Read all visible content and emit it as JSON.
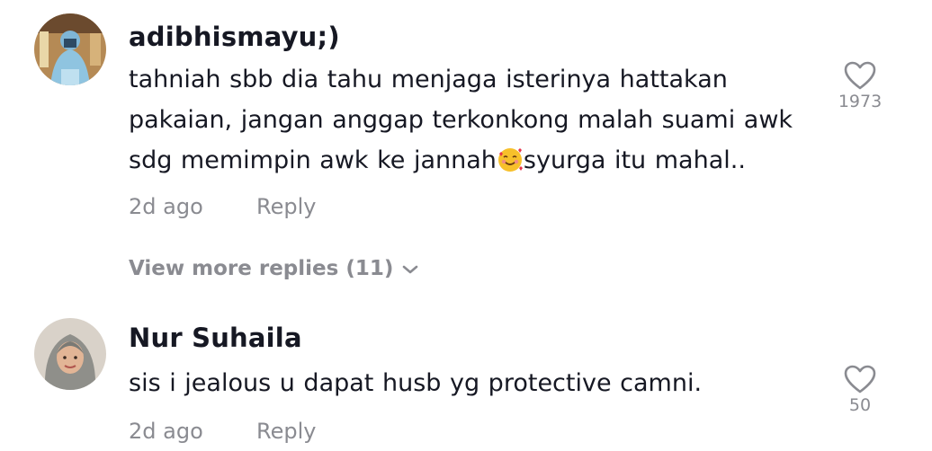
{
  "comments": [
    {
      "username": "adibhismayu;)",
      "text_before_emoji": "tahniah sbb dia tahu menjaga isterinya hattakan pakaian, jangan anggap terkonkong malah suami awk sdg memimpin awk ke jannah",
      "emoji": "smiling-face-with-hearts",
      "text_after_emoji": "syurga itu mahal..",
      "time": "2d ago",
      "reply_label": "Reply",
      "like_count": "1973",
      "view_more_label": "View more replies (11)"
    },
    {
      "username": "Nur Suhaila",
      "text": "sis i jealous u dapat husb yg protective camni.",
      "time": "2d ago",
      "reply_label": "Reply",
      "like_count": "50"
    }
  ],
  "icons": {
    "like": "heart-outline-icon",
    "expand": "chevron-down-icon"
  },
  "colors": {
    "text_primary": "#161823",
    "text_secondary": "#8a8b91"
  }
}
